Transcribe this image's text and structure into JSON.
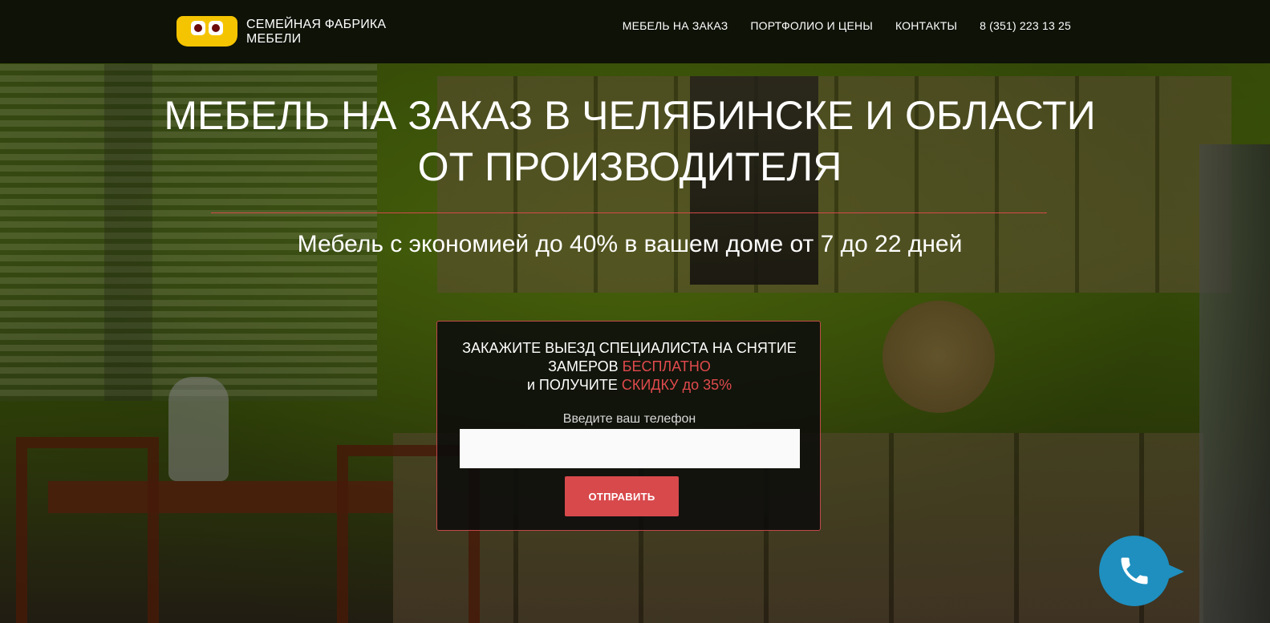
{
  "header": {
    "brand_line1": "СЕМЕЙНАЯ ФАБРИКА",
    "brand_line2": "МЕБЕЛИ",
    "nav": [
      {
        "label": "МЕБЕЛЬ НА ЗАКАЗ"
      },
      {
        "label": "ПОРТФОЛИО И ЦЕНЫ"
      },
      {
        "label": "КОНТАКТЫ"
      },
      {
        "label": "8 (351) 223 13 25"
      }
    ]
  },
  "hero": {
    "title_line1": "МЕБЕЛЬ НА ЗАКАЗ В ЧЕЛЯБИНСКЕ И ОБЛАСТИ",
    "title_line2": "ОТ ПРОИЗВОДИТЕЛЯ",
    "subtitle": "Мебель с экономией до 40% в вашем доме от 7 до 22 дней"
  },
  "form": {
    "title_part1": "ЗАКАЖИТЕ ВЫЕЗД СПЕЦИАЛИСТА НА СНЯТИЕ ЗАМЕРОВ",
    "title_highlight1": "БЕСПЛАТНО",
    "title_part2": "и ПОЛУЧИТЕ",
    "title_highlight2": "СКИДКУ до 35%",
    "phone_label": "Введите ваш телефон",
    "phone_value": "",
    "submit_label": "ОТПРАВИТЬ"
  },
  "colors": {
    "accent": "#d8494c",
    "logo_yellow": "#f5c400",
    "call_widget": "#1e8fbf"
  },
  "icons": {
    "logo": "logo-mark",
    "call_widget": "phone-icon"
  }
}
